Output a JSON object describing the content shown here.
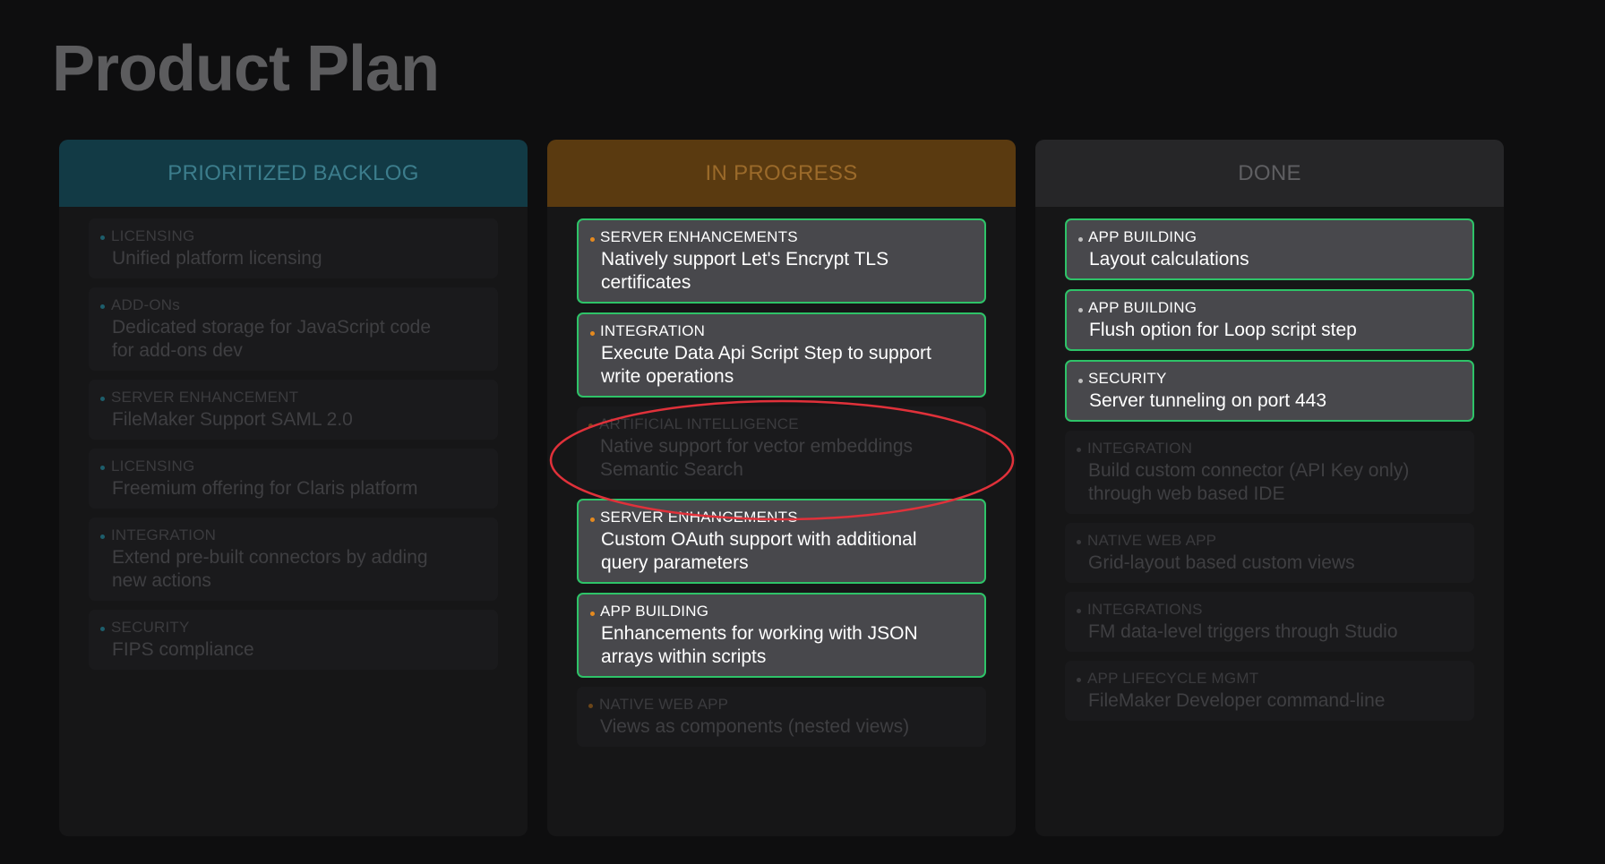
{
  "page": {
    "title": "Product Plan"
  },
  "columns": [
    {
      "header": "PRIORITIZED BACKLOG",
      "cards": [
        {
          "category": "LICENSING",
          "title": "Unified platform licensing",
          "state": "dim"
        },
        {
          "category": "ADD-ONs",
          "title": "Dedicated storage for JavaScript code for add-ons dev",
          "state": "dim"
        },
        {
          "category": "SERVER ENHANCEMENT",
          "title": "FileMaker Support SAML 2.0",
          "state": "dim"
        },
        {
          "category": "LICENSING",
          "title": "Freemium offering for Claris platform",
          "state": "dim"
        },
        {
          "category": "INTEGRATION",
          "title": "Extend pre-built connectors by adding new actions",
          "state": "dim"
        },
        {
          "category": "SECURITY",
          "title": "FIPS compliance",
          "state": "dim"
        }
      ]
    },
    {
      "header": "IN PROGRESS",
      "cards": [
        {
          "category": "SERVER ENHANCEMENTS",
          "title": "Natively support Let's Encrypt TLS certificates",
          "state": "active"
        },
        {
          "category": "INTEGRATION",
          "title": "Execute Data Api Script Step to support write operations",
          "state": "active"
        },
        {
          "category": "ARTIFICIAL INTELLIGENCE",
          "title": "Native support for vector embeddings Semantic Search",
          "state": "dim"
        },
        {
          "category": "SERVER ENHANCEMENTS",
          "title": "Custom OAuth support with additional query parameters",
          "state": "active"
        },
        {
          "category": "APP BUILDING",
          "title": "Enhancements for working with JSON arrays within scripts",
          "state": "active"
        },
        {
          "category": "NATIVE WEB APP",
          "title": "Views as components (nested views)",
          "state": "dim"
        }
      ]
    },
    {
      "header": "DONE",
      "cards": [
        {
          "category": "APP BUILDING",
          "title": "Layout calculations",
          "state": "active"
        },
        {
          "category": "APP BUILDING",
          "title": "Flush option for Loop script step",
          "state": "active"
        },
        {
          "category": "SECURITY",
          "title": "Server tunneling on port 443",
          "state": "active"
        },
        {
          "category": "INTEGRATION",
          "title": "Build custom connector (API Key only) through web based IDE",
          "state": "dim"
        },
        {
          "category": "NATIVE WEB APP",
          "title": "Grid-layout based custom views",
          "state": "dim"
        },
        {
          "category": "INTEGRATIONS",
          "title": "FM data-level triggers through Studio",
          "state": "dim"
        },
        {
          "category": "APP LIFECYCLE MGMT",
          "title": "FileMaker Developer command-line",
          "state": "dim"
        }
      ]
    }
  ],
  "colors": {
    "background": "#0e0e0f",
    "backlog_header": "#123a45",
    "in_progress_header": "#5a3a10",
    "done_header": "#262628",
    "active_card_border": "#2ec368",
    "highlight_ellipse": "#e0313a"
  }
}
